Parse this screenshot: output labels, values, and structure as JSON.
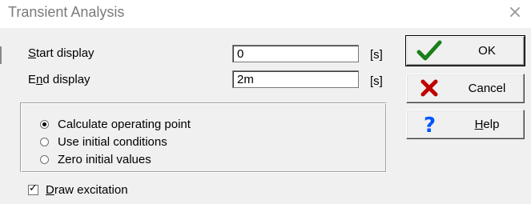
{
  "window": {
    "title": "Transient Analysis",
    "close_glyph": "×"
  },
  "fields": {
    "start_display": {
      "label_prefix": "",
      "label_accel": "S",
      "label_rest": "tart display",
      "value": "0",
      "unit": "[s]"
    },
    "end_display": {
      "label_prefix": "E",
      "label_accel": "n",
      "label_rest": "d display",
      "value": "2m",
      "unit": "[s]"
    }
  },
  "options": {
    "selected": "Calculate operating point",
    "items": [
      {
        "label": "Calculate operating point",
        "selected": true
      },
      {
        "label": "Use initial conditions",
        "selected": false
      },
      {
        "label": "Zero initial values",
        "selected": false
      }
    ]
  },
  "draw_excitation": {
    "checked": true,
    "label_accel": "D",
    "label_rest": "raw excitation"
  },
  "buttons": {
    "ok": {
      "label": "OK",
      "icon": "checkmark-icon",
      "color": "#1a7f1a"
    },
    "cancel": {
      "label": "Cancel",
      "icon": "red-x-icon",
      "color": "#c00000"
    },
    "help": {
      "label_accel": "H",
      "label_rest": "elp",
      "icon": "question-mark-icon",
      "color": "#0055ff"
    }
  }
}
